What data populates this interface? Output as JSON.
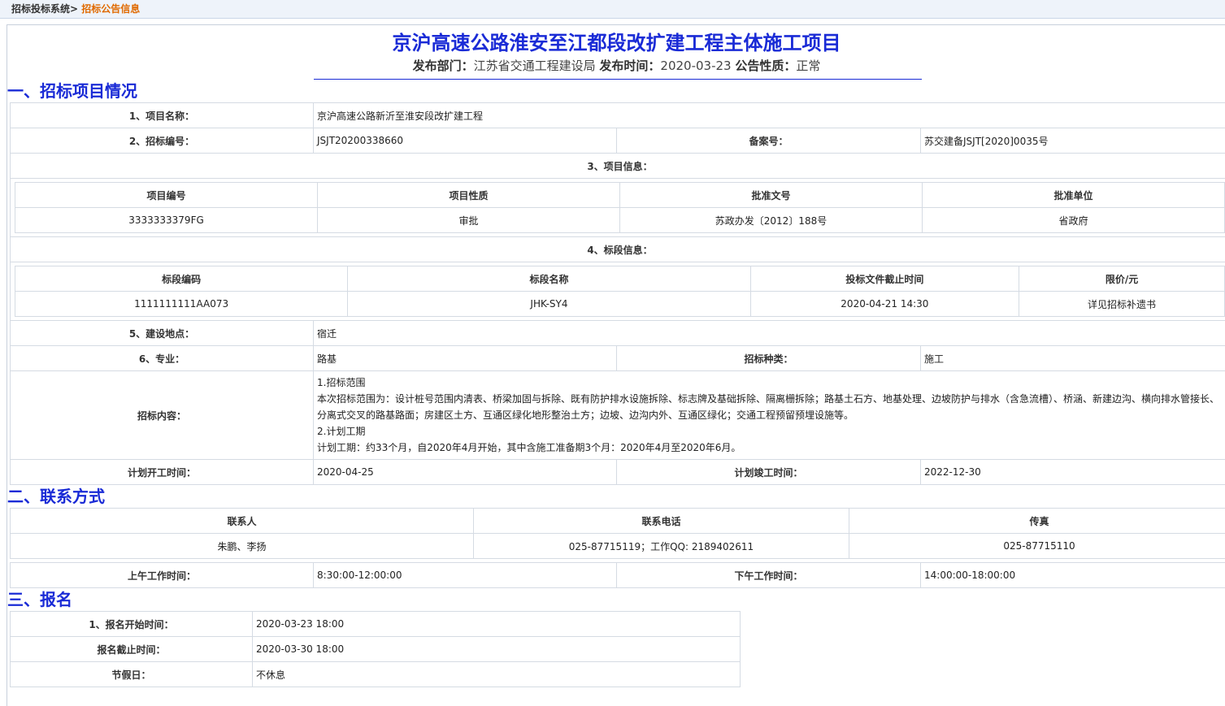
{
  "breadcrumb": {
    "root": "招标投标系统>",
    "current": "招标公告信息"
  },
  "title": "京沪高速公路淮安至江都段改扩建工程主体施工项目",
  "meta": {
    "dept_label": "发布部门：",
    "dept_value": "江苏省交通工程建设局",
    "time_label": "发布时间：",
    "time_value": "2020-03-23",
    "nature_label": "公告性质：",
    "nature_value": "正常"
  },
  "sections": {
    "project": "一、招标项目情况",
    "contact": "二、联系方式",
    "registration": "三、报名"
  },
  "project": {
    "name_label": "1、项目名称：",
    "name_value": "京沪高速公路新沂至淮安段改扩建工程",
    "code_label": "2、招标编号：",
    "code_value": "JSJT20200338660",
    "record_label": "备案号：",
    "record_value": "苏交建备JSJT[2020]0035号",
    "info_label": "3、项目信息：",
    "info_headers": [
      "项目编号",
      "项目性质",
      "批准文号",
      "批准单位"
    ],
    "info_row": [
      "3333333379FG",
      "审批",
      "苏政办发〔2012〕188号",
      "省政府"
    ],
    "section_label": "4、标段信息：",
    "section_headers": [
      "标段编码",
      "标段名称",
      "投标文件截止时间",
      "限价/元"
    ],
    "section_row": [
      "1111111111AA073",
      "JHK-SY4",
      "2020-04-21 14:30",
      "详见招标补遗书"
    ],
    "location_label": "5、建设地点：",
    "location_value": "宿迁",
    "major_label": "6、专业：",
    "major_value": "路基",
    "type_label": "招标种类：",
    "type_value": "施工",
    "content_label": "招标内容：",
    "content_lines": [
      "1.招标范围",
      "本次招标范围为：设计桩号范围内清表、桥梁加固与拆除、既有防护排水设施拆除、标志牌及基础拆除、隔离栅拆除；路基土石方、地基处理、边坡防护与排水（含急流槽）、桥涵、新建边沟、横向排水管接长、分离式交叉的路基路面；房建区土方、互通区绿化地形整治土方；边坡、边沟内外、互通区绿化；交通工程预留预埋设施等。",
      "2.计划工期",
      "计划工期：约33个月，自2020年4月开始，其中含施工准备期3个月：2020年4月至2020年6月。"
    ],
    "start_label": "计划开工时间：",
    "start_value": "2020-04-25",
    "end_label": "计划竣工时间：",
    "end_value": "2022-12-30"
  },
  "contact": {
    "headers": [
      "联系人",
      "联系电话",
      "传真"
    ],
    "row": [
      "朱鹏、李扬",
      "025-87715119；工作QQ: 2189402611",
      "025-87715110"
    ],
    "am_label": "上午工作时间：",
    "am_value": "8:30:00-12:00:00",
    "pm_label": "下午工作时间：",
    "pm_value": "14:00:00-18:00:00"
  },
  "registration": {
    "start_label": "1、报名开始时间：",
    "start_value": "2020-03-23 18:00",
    "end_label": "报名截止时间：",
    "end_value": "2020-03-30 18:00",
    "holiday_label": "节假日：",
    "holiday_value": "不休息"
  }
}
